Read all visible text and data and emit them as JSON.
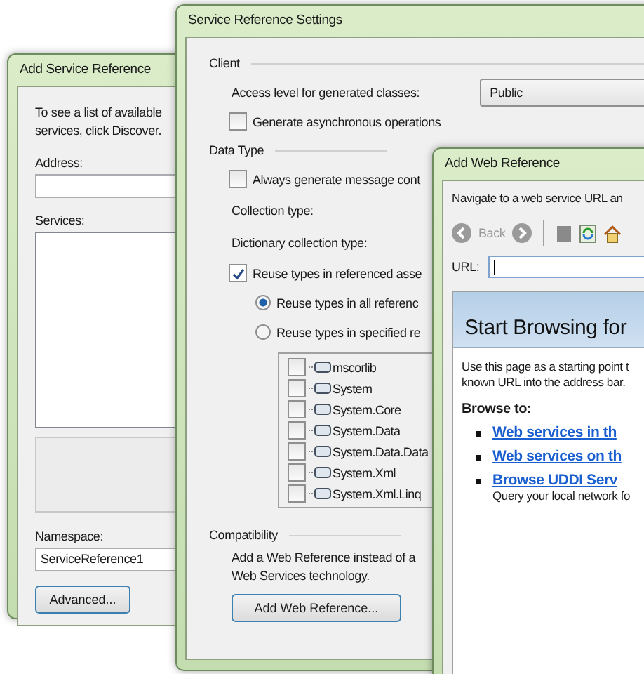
{
  "add_service_reference": {
    "title": "Add Service Reference",
    "intro": [
      "To see a list of available",
      "services, click Discover."
    ],
    "address": {
      "label": "Address:"
    },
    "services": {
      "label": "Services:"
    },
    "namespace": {
      "label": "Namespace:",
      "value": "ServiceReference1"
    },
    "advanced_button": "Advanced..."
  },
  "service_reference_settings": {
    "title": "Service Reference Settings",
    "client": {
      "heading": "Client",
      "access_level": {
        "label": "Access level for generated classes:",
        "value": "Public"
      },
      "async": {
        "label": "Generate asynchronous operations",
        "checked": false
      }
    },
    "data_type": {
      "heading": "Data Type",
      "always_generate": {
        "label": "Always generate message cont",
        "checked": false
      },
      "collection_type": {
        "label": "Collection type:"
      },
      "dictionary_type": {
        "label": "Dictionary collection type:"
      },
      "reuse_types": {
        "label": "Reuse types in referenced asse",
        "checked": true
      },
      "reuse_options": [
        {
          "label": "Reuse types in all referenc",
          "selected": true
        },
        {
          "label": "Reuse types in specified re",
          "selected": false
        }
      ],
      "assemblies": [
        {
          "name": "mscorlib",
          "checked": false
        },
        {
          "name": "System",
          "checked": false
        },
        {
          "name": "System.Core",
          "checked": false
        },
        {
          "name": "System.Data",
          "checked": false
        },
        {
          "name": "System.Data.Data",
          "checked": false
        },
        {
          "name": "System.Xml",
          "checked": false
        },
        {
          "name": "System.Xml.Linq",
          "checked": false
        }
      ]
    },
    "compatibility": {
      "heading": "Compatibility",
      "text": [
        "Add a Web Reference instead of a",
        "Web Services technology."
      ],
      "button": "Add Web Reference..."
    }
  },
  "add_web_reference": {
    "title": "Add Web Reference",
    "instruction": "Navigate to a web service URL an",
    "back": {
      "label": "Back",
      "disabled": true
    },
    "url": {
      "label": "URL:"
    },
    "browser": {
      "heading": "Start Browsing for",
      "intro": [
        "Use this page as a starting point t",
        "known URL into the address bar."
      ],
      "browse_to": "Browse to:",
      "links": [
        {
          "label": "Web services in th"
        },
        {
          "label": "Web services on th"
        },
        {
          "label": "Browse UDDI Serv",
          "description": "Query your local network fo"
        }
      ]
    }
  }
}
